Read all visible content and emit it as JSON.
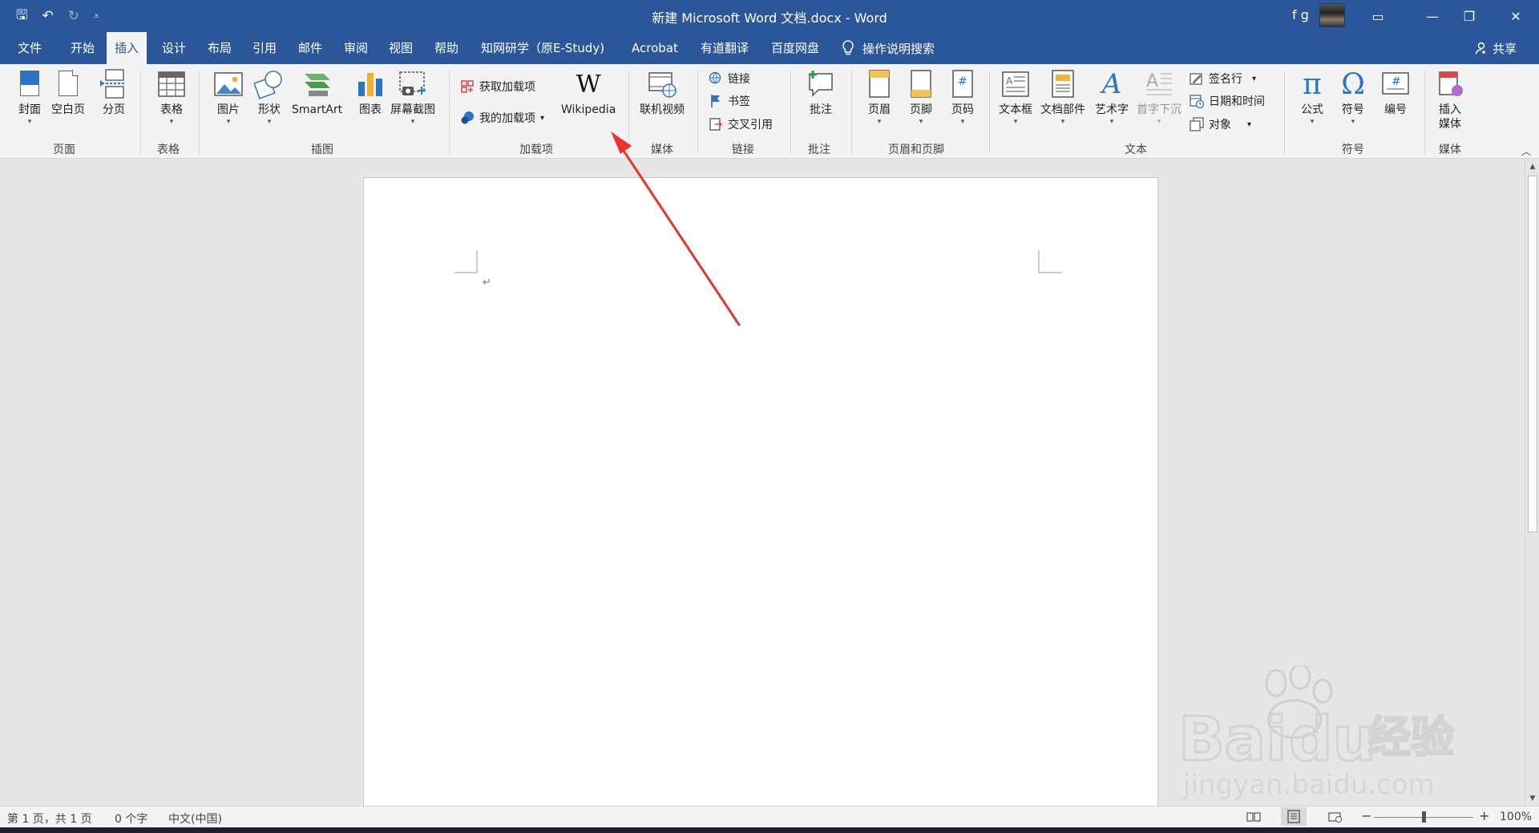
{
  "window": {
    "title": "新建 Microsoft Word 文档.docx  -  Word",
    "user": "f g",
    "controls": {
      "ribbon_display": "▭",
      "minimize": "—",
      "restore": "❐",
      "close": "✕"
    }
  },
  "qat": {
    "save": "🖫",
    "undo": "↶",
    "redo": "↻",
    "customize": "⩡"
  },
  "tabs": [
    {
      "label": "文件"
    },
    {
      "label": "开始"
    },
    {
      "label": "插入"
    },
    {
      "label": "设计"
    },
    {
      "label": "布局"
    },
    {
      "label": "引用"
    },
    {
      "label": "邮件"
    },
    {
      "label": "审阅"
    },
    {
      "label": "视图"
    },
    {
      "label": "帮助"
    },
    {
      "label": "知网研学（原E-Study)"
    },
    {
      "label": "Acrobat"
    },
    {
      "label": "有道翻译"
    },
    {
      "label": "百度网盘"
    }
  ],
  "active_tab": "插入",
  "tell_me": "操作说明搜索",
  "share": "共享",
  "ribbon": {
    "pages": {
      "label": "页面",
      "cover": "封面",
      "blank": "空白页",
      "break": "分页"
    },
    "tables": {
      "label": "表格",
      "table": "表格"
    },
    "illustrations": {
      "label": "插图",
      "pictures": "图片",
      "shapes": "形状",
      "smartart": "SmartArt",
      "chart": "图表",
      "screenshot": "屏幕截图"
    },
    "addins": {
      "label": "加载项",
      "get": "获取加载项",
      "my": "我的加载项",
      "wikipedia": "Wikipedia",
      "wiki_glyph": "W"
    },
    "media": {
      "label": "媒体",
      "online_video": "联机视频"
    },
    "links": {
      "label": "链接",
      "link": "链接",
      "bookmark": "书签",
      "cross_ref": "交叉引用"
    },
    "comments": {
      "label": "批注",
      "comment": "批注"
    },
    "header_footer": {
      "label": "页眉和页脚",
      "header": "页眉",
      "footer": "页脚",
      "page_number": "页码"
    },
    "text": {
      "label": "文本",
      "textbox": "文本框",
      "quick_parts": "文档部件",
      "wordart": "艺术字",
      "dropcap": "首字下沉",
      "signature": "签名行",
      "datetime": "日期和时间",
      "object": "对象"
    },
    "symbols": {
      "label": "符号",
      "equation": "公式",
      "symbol": "符号",
      "number": "编号",
      "pi": "π",
      "omega": "Ω",
      "hash": "#"
    },
    "media2": {
      "label": "媒体",
      "insert_media": "插入\n媒体"
    },
    "dropdown_glyph": "▾"
  },
  "document": {
    "paragraph_mark": "↵"
  },
  "status": {
    "page": "第 1 页，共 1 页",
    "words": "0 个字",
    "language": "中文(中国)",
    "zoom": "100%",
    "zoom_minus": "−",
    "zoom_plus": "+",
    "zoom_fraction": 0.5
  },
  "watermark": {
    "brand": "Bai",
    "brand2": "du",
    "cn": "经验",
    "url": "jingyan.baidu.com"
  },
  "colors": {
    "titlebar": "#2b579a",
    "ribbon": "#f3f3f3",
    "annotation": "#e8332f"
  }
}
